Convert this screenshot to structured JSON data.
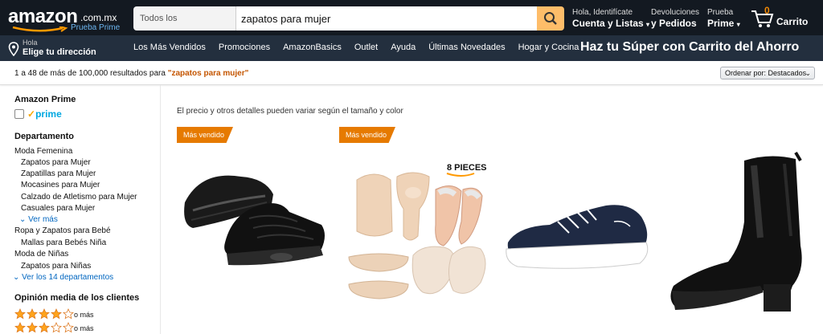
{
  "header": {
    "logo_text": "amazon",
    "logo_tld": ".com.mx",
    "logo_sub": "Prueba Prime",
    "search_dept": "Todos los departamentos",
    "search_value": "zapatos para mujer",
    "account_l1": "Hola, Identifícate",
    "account_l2": "Cuenta y Listas",
    "orders_l1": "Devoluciones",
    "orders_l2": "y Pedidos",
    "prime_l1": "Prueba",
    "prime_l2": "Prime",
    "cart_count": "0",
    "cart_label": "Carrito"
  },
  "subnav": {
    "addr_l1": "Hola",
    "addr_l2": "Elige tu dirección",
    "links": [
      "Los Más Vendidos",
      "Promociones",
      "AmazonBasics",
      "Outlet",
      "Ayuda",
      "Últimas Novedades",
      "Hogar y Cocina"
    ],
    "promo": "Haz tu Súper con Carrito del Ahorro"
  },
  "results": {
    "text": "1 a 48 de más de 100,000 resultados para",
    "query": "\"zapatos para mujer\"",
    "sort_label": "Ordenar por:",
    "sort_value": "Destacados"
  },
  "sidebar": {
    "prime_heading": "Amazon Prime",
    "prime_logo": "prime",
    "dept_heading": "Departamento",
    "dept_items": [
      "Moda Femenina",
      "Zapatos para Mujer",
      "Zapatillas para Mujer",
      "Mocasines para Mujer",
      "Calzado de Atletismo para Mujer",
      "Casuales para Mujer",
      "Ver más",
      "Ropa y Zapatos para Bebé",
      "Mallas para Bebés Niña",
      "Moda de Niñas",
      "Zapatos para Niñas",
      "Ver los 14 departamentos"
    ],
    "rating_heading": "Opinión media de los clientes",
    "rating_suffix": "o más",
    "ratings": [
      4,
      3
    ]
  },
  "main": {
    "note": "El precio y otros detalles pueden variar según el tamaño y color",
    "badge": "Más vendido",
    "pieces_label": "8 PIECES"
  },
  "colors": {
    "nav_bg": "#131921",
    "subnav_bg": "#232f3e",
    "search_btn": "#febd69",
    "badge": "#e67a00",
    "link": "#0066c0",
    "query": "#c45500"
  }
}
